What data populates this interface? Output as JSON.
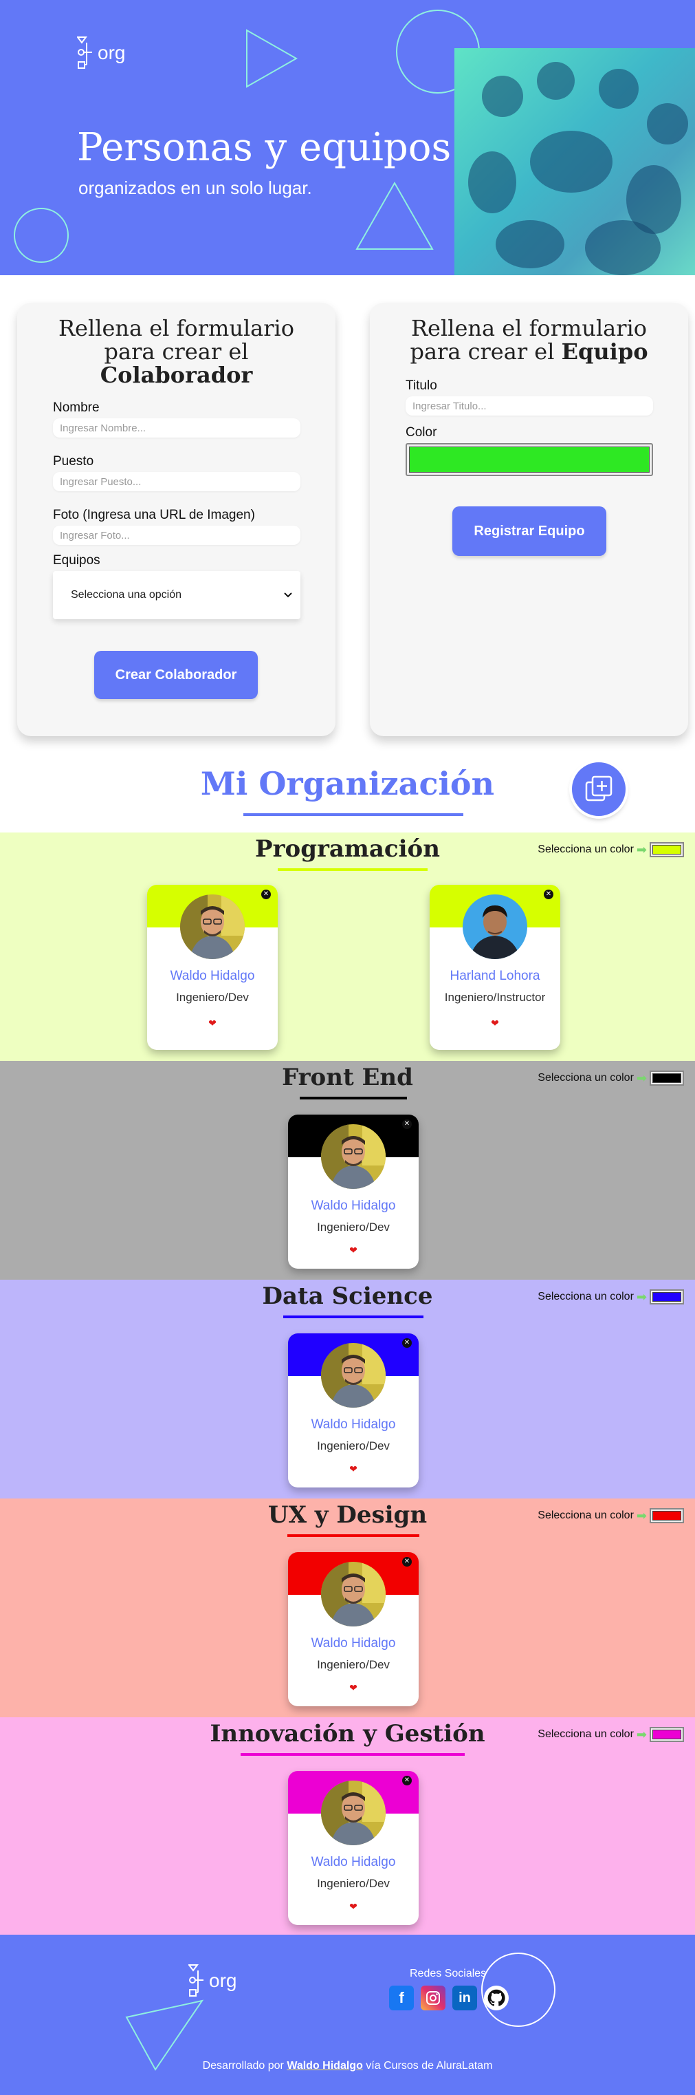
{
  "header": {
    "logo_text": "org",
    "title": "Personas y equipos",
    "subtitle": "organizados en un solo lugar."
  },
  "form_collaborator": {
    "title_line1": "Rellena el formulario",
    "title_line2": "para crear el",
    "title_strong": "Colaborador",
    "fields": [
      {
        "label": "Nombre",
        "placeholder": "Ingresar Nombre..."
      },
      {
        "label": "Puesto",
        "placeholder": "Ingresar Puesto..."
      },
      {
        "label": "Foto (Ingresa una URL de Imagen)",
        "placeholder": "Ingresar Foto..."
      }
    ],
    "select_label": "Equipos",
    "select_value": "Selecciona una opción",
    "submit": "Crear Colaborador"
  },
  "form_team": {
    "title_line1": "Rellena el formulario",
    "title_line2": "para crear el",
    "title_strong": "Equipo",
    "title_label": "Titulo",
    "title_placeholder": "Ingresar Titulo...",
    "color_label": "Color",
    "color_value": "#2ee823",
    "submit": "Registrar Equipo"
  },
  "organization": {
    "title": "Mi Organización",
    "accent": "#6278f7"
  },
  "color_picker_label": "Selecciona un color",
  "teams": [
    {
      "title": "Programación",
      "primary": "#d6ff00",
      "background": "#eeffc1",
      "members": [
        {
          "name": "Waldo Hidalgo",
          "role": "Ingeniero/Dev"
        },
        {
          "name": "Harland Lohora",
          "role": "Ingeniero/Instructor"
        }
      ]
    },
    {
      "title": "Front End",
      "primary": "#000000",
      "background": "#acacac",
      "members": [
        {
          "name": "Waldo Hidalgo",
          "role": "Ingeniero/Dev"
        }
      ]
    },
    {
      "title": "Data Science",
      "primary": "#2000ff",
      "background": "#bdb5fb",
      "members": [
        {
          "name": "Waldo Hidalgo",
          "role": "Ingeniero/Dev"
        }
      ]
    },
    {
      "title": "UX y Design",
      "primary": "#f20000",
      "background": "#fdb2aa",
      "members": [
        {
          "name": "Waldo Hidalgo",
          "role": "Ingeniero/Dev"
        }
      ]
    },
    {
      "title": "Innovación y Gestión",
      "primary": "#ec00d3",
      "background": "#fdb1ec",
      "members": [
        {
          "name": "Waldo Hidalgo",
          "role": "Ingeniero/Dev"
        }
      ]
    }
  ],
  "footer": {
    "logo_text": "org",
    "social_title": "Redes Sociales",
    "social_icons": [
      "facebook-icon",
      "instagram-icon",
      "linkedin-icon",
      "github-icon"
    ],
    "dev_prefix": "Desarrollado por",
    "dev_author": "Waldo Hidalgo",
    "dev_suffix": "vía Cursos de AluraLatam"
  }
}
